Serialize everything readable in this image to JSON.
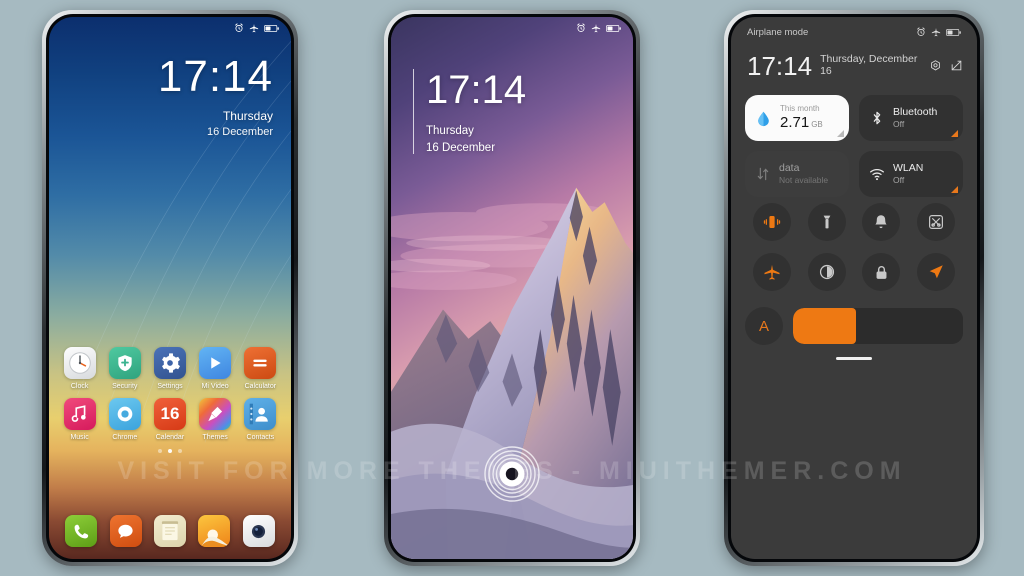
{
  "background_color": "#a6bac1",
  "watermark": "VISIT FOR MORE THEMES - MIUITHEMER.COM",
  "status_bar": {
    "icons": [
      "alarm-icon",
      "airplane-mode-icon",
      "battery-icon"
    ]
  },
  "phone1": {
    "name": "lockscreen-blue-gradient",
    "lock": {
      "time": "17:14",
      "weekday": "Thursday",
      "date": "16 December"
    },
    "apps_row1": [
      {
        "label": "Clock",
        "icon": "clock-icon",
        "color": "#eceff1"
      },
      {
        "label": "Security",
        "icon": "shield-icon",
        "color": "#3fba94"
      },
      {
        "label": "Settings",
        "icon": "gear-icon",
        "color": "#3d63a8"
      },
      {
        "label": "Mi Video",
        "icon": "play-icon",
        "color": "#4ea2ef"
      },
      {
        "label": "Calculator",
        "icon": "equals-icon",
        "color": "#de5a1c"
      }
    ],
    "apps_row2": [
      {
        "label": "Music",
        "icon": "music-note-icon",
        "color": "#e8356d"
      },
      {
        "label": "Chrome",
        "icon": "chrome-icon",
        "color": "#56b9e8"
      },
      {
        "label": "Calendar",
        "icon": "calendar-icon",
        "color": "#e8502a",
        "day": "16"
      },
      {
        "label": "Themes",
        "icon": "brush-icon",
        "color": "#9b59c6"
      },
      {
        "label": "Contacts",
        "icon": "person-icon",
        "color": "#4a9fdc"
      }
    ],
    "page_dots": {
      "count": 3,
      "active_index": 1
    },
    "dock": [
      {
        "label": "Phone",
        "icon": "phone-handset-icon",
        "color": "#76b82a"
      },
      {
        "label": "Messages",
        "icon": "chat-bubble-icon",
        "color": "#de5c16"
      },
      {
        "label": "Notes",
        "icon": "notepad-icon",
        "color": "#e8e2c0"
      },
      {
        "label": "Gallery",
        "icon": "sunset-image-icon",
        "color": "#f0a018"
      },
      {
        "label": "Camera",
        "icon": "camera-lens-icon",
        "color": "#f4f4f4"
      }
    ]
  },
  "phone2": {
    "name": "lockscreen-mountain-sunset",
    "lock": {
      "time": "17:14",
      "weekday": "Thursday",
      "date": "16 December"
    },
    "fingerprint_icon": "fingerprint-unlock-icon"
  },
  "phone3": {
    "name": "control-center",
    "header": {
      "airplane_label": "Airplane mode",
      "time": "17:14",
      "date": "Thursday, December 16",
      "settings_icon": "gear-icon",
      "edit_icon": "edit-pencil-icon"
    },
    "cards": [
      {
        "name": "data-usage-card",
        "style": "light",
        "icon": "water-drop-icon",
        "title": "This month",
        "value": "2.71",
        "unit": "GB",
        "corner": "gray"
      },
      {
        "name": "bluetooth-card",
        "style": "dark",
        "icon": "bluetooth-icon",
        "title": "Bluetooth",
        "sub": "Off",
        "corner": "orange"
      },
      {
        "name": "mobile-data-card",
        "style": "disabled",
        "icon": "data-transfer-icon",
        "title": "data",
        "sub": "Not available",
        "corner": "none"
      },
      {
        "name": "wlan-card",
        "style": "dark",
        "icon": "wifi-icon",
        "title": "WLAN",
        "sub": "Off",
        "corner": "orange"
      }
    ],
    "toggles": [
      {
        "name": "vibrate-toggle",
        "icon": "vibrate-icon",
        "active": true
      },
      {
        "name": "flashlight-toggle",
        "icon": "flashlight-icon",
        "active": false
      },
      {
        "name": "silent-toggle",
        "icon": "bell-icon",
        "active": false
      },
      {
        "name": "screenshot-toggle",
        "icon": "screenshot-icon",
        "active": false
      },
      {
        "name": "airplane-toggle",
        "icon": "airplane-icon",
        "active": true
      },
      {
        "name": "darkmode-toggle",
        "icon": "contrast-icon",
        "active": false
      },
      {
        "name": "lock-toggle",
        "icon": "lock-icon",
        "active": false
      },
      {
        "name": "location-toggle",
        "icon": "location-arrow-icon",
        "active": true
      }
    ],
    "brightness": {
      "auto_label": "A",
      "level_percent": 37,
      "fill_color": "#ee7913"
    }
  }
}
